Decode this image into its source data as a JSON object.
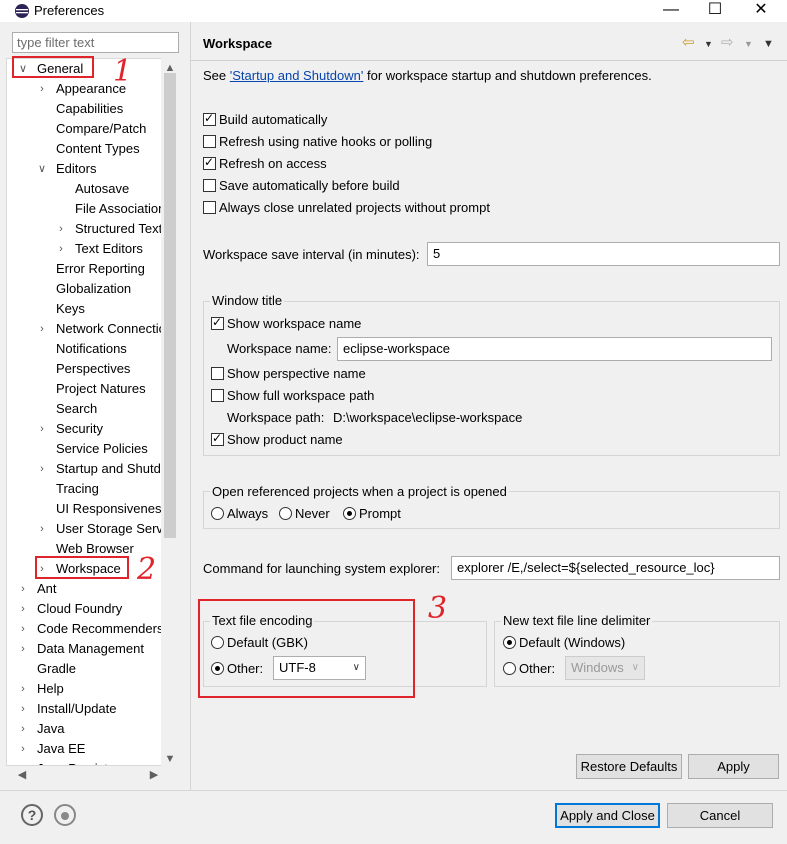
{
  "window": {
    "title": "Preferences",
    "minimize": "—",
    "maximize": "☐",
    "close": "✕"
  },
  "filter": {
    "placeholder": "type filter text"
  },
  "tree": [
    {
      "label": "General",
      "indent": 0,
      "chev": "∨"
    },
    {
      "label": "Appearance",
      "indent": 1,
      "chev": "›"
    },
    {
      "label": "Capabilities",
      "indent": 1,
      "chev": ""
    },
    {
      "label": "Compare/Patch",
      "indent": 1,
      "chev": ""
    },
    {
      "label": "Content Types",
      "indent": 1,
      "chev": ""
    },
    {
      "label": "Editors",
      "indent": 1,
      "chev": "∨"
    },
    {
      "label": "Autosave",
      "indent": 2,
      "chev": ""
    },
    {
      "label": "File Associations",
      "indent": 2,
      "chev": ""
    },
    {
      "label": "Structured Text",
      "indent": 2,
      "chev": "›"
    },
    {
      "label": "Text Editors",
      "indent": 2,
      "chev": "›"
    },
    {
      "label": "Error Reporting",
      "indent": 1,
      "chev": ""
    },
    {
      "label": "Globalization",
      "indent": 1,
      "chev": ""
    },
    {
      "label": "Keys",
      "indent": 1,
      "chev": ""
    },
    {
      "label": "Network Connections",
      "indent": 1,
      "chev": "›"
    },
    {
      "label": "Notifications",
      "indent": 1,
      "chev": ""
    },
    {
      "label": "Perspectives",
      "indent": 1,
      "chev": ""
    },
    {
      "label": "Project Natures",
      "indent": 1,
      "chev": ""
    },
    {
      "label": "Search",
      "indent": 1,
      "chev": ""
    },
    {
      "label": "Security",
      "indent": 1,
      "chev": "›"
    },
    {
      "label": "Service Policies",
      "indent": 1,
      "chev": ""
    },
    {
      "label": "Startup and Shutdown",
      "indent": 1,
      "chev": "›"
    },
    {
      "label": "Tracing",
      "indent": 1,
      "chev": ""
    },
    {
      "label": "UI Responsiveness",
      "indent": 1,
      "chev": ""
    },
    {
      "label": "User Storage Service",
      "indent": 1,
      "chev": "›"
    },
    {
      "label": "Web Browser",
      "indent": 1,
      "chev": ""
    },
    {
      "label": "Workspace",
      "indent": 1,
      "chev": "›"
    },
    {
      "label": "Ant",
      "indent": 0,
      "chev": "›"
    },
    {
      "label": "Cloud Foundry",
      "indent": 0,
      "chev": "›"
    },
    {
      "label": "Code Recommenders",
      "indent": 0,
      "chev": "›"
    },
    {
      "label": "Data Management",
      "indent": 0,
      "chev": "›"
    },
    {
      "label": "Gradle",
      "indent": 0,
      "chev": ""
    },
    {
      "label": "Help",
      "indent": 0,
      "chev": "›"
    },
    {
      "label": "Install/Update",
      "indent": 0,
      "chev": "›"
    },
    {
      "label": "Java",
      "indent": 0,
      "chev": "›"
    },
    {
      "label": "Java EE",
      "indent": 0,
      "chev": "›"
    },
    {
      "label": "Java Persistence",
      "indent": 0,
      "chev": "›"
    }
  ],
  "page": {
    "title": "Workspace",
    "see_prefix": "See ",
    "see_link": "'Startup and Shutdown'",
    "see_suffix": " for workspace startup and shutdown preferences.",
    "build_automatically": "Build automatically",
    "refresh_native": "Refresh using native hooks or polling",
    "refresh_access": "Refresh on access",
    "save_before_build": "Save automatically before build",
    "close_unrelated": "Always close unrelated projects without prompt",
    "save_interval_label": "Workspace save interval (in minutes):",
    "save_interval_value": "5",
    "window_title_group": "Window title",
    "show_ws_name": "Show workspace name",
    "ws_name_label": "Workspace name:",
    "ws_name_value": "eclipse-workspace",
    "show_perspective": "Show perspective name",
    "show_full_path": "Show full workspace path",
    "ws_path_label": "Workspace path:",
    "ws_path_value": "D:\\workspace\\eclipse-workspace",
    "show_product": "Show product name",
    "open_ref_group": "Open referenced projects when a project is opened",
    "always": "Always",
    "never": "Never",
    "prompt": "Prompt",
    "explorer_label": "Command for launching system explorer:",
    "explorer_value": "explorer /E,/select=${selected_resource_loc}",
    "encoding_group": "Text file encoding",
    "default_gbk": "Default (GBK)",
    "other": "Other:",
    "encoding_value": "UTF-8",
    "delimiter_group": "New text file line delimiter",
    "default_windows": "Default (Windows)",
    "other2": "Other:",
    "delimiter_value": "Windows",
    "restore_defaults": "Restore Defaults",
    "apply": "Apply"
  },
  "footer": {
    "help_icon": "?",
    "apply_close": "Apply and Close",
    "cancel": "Cancel"
  },
  "annotations": {
    "one": "1",
    "two": "2",
    "three": "3"
  },
  "colors": {
    "annotation_red": "#e0242b",
    "accent_blue": "#0078d7",
    "link": "#0645ad"
  }
}
